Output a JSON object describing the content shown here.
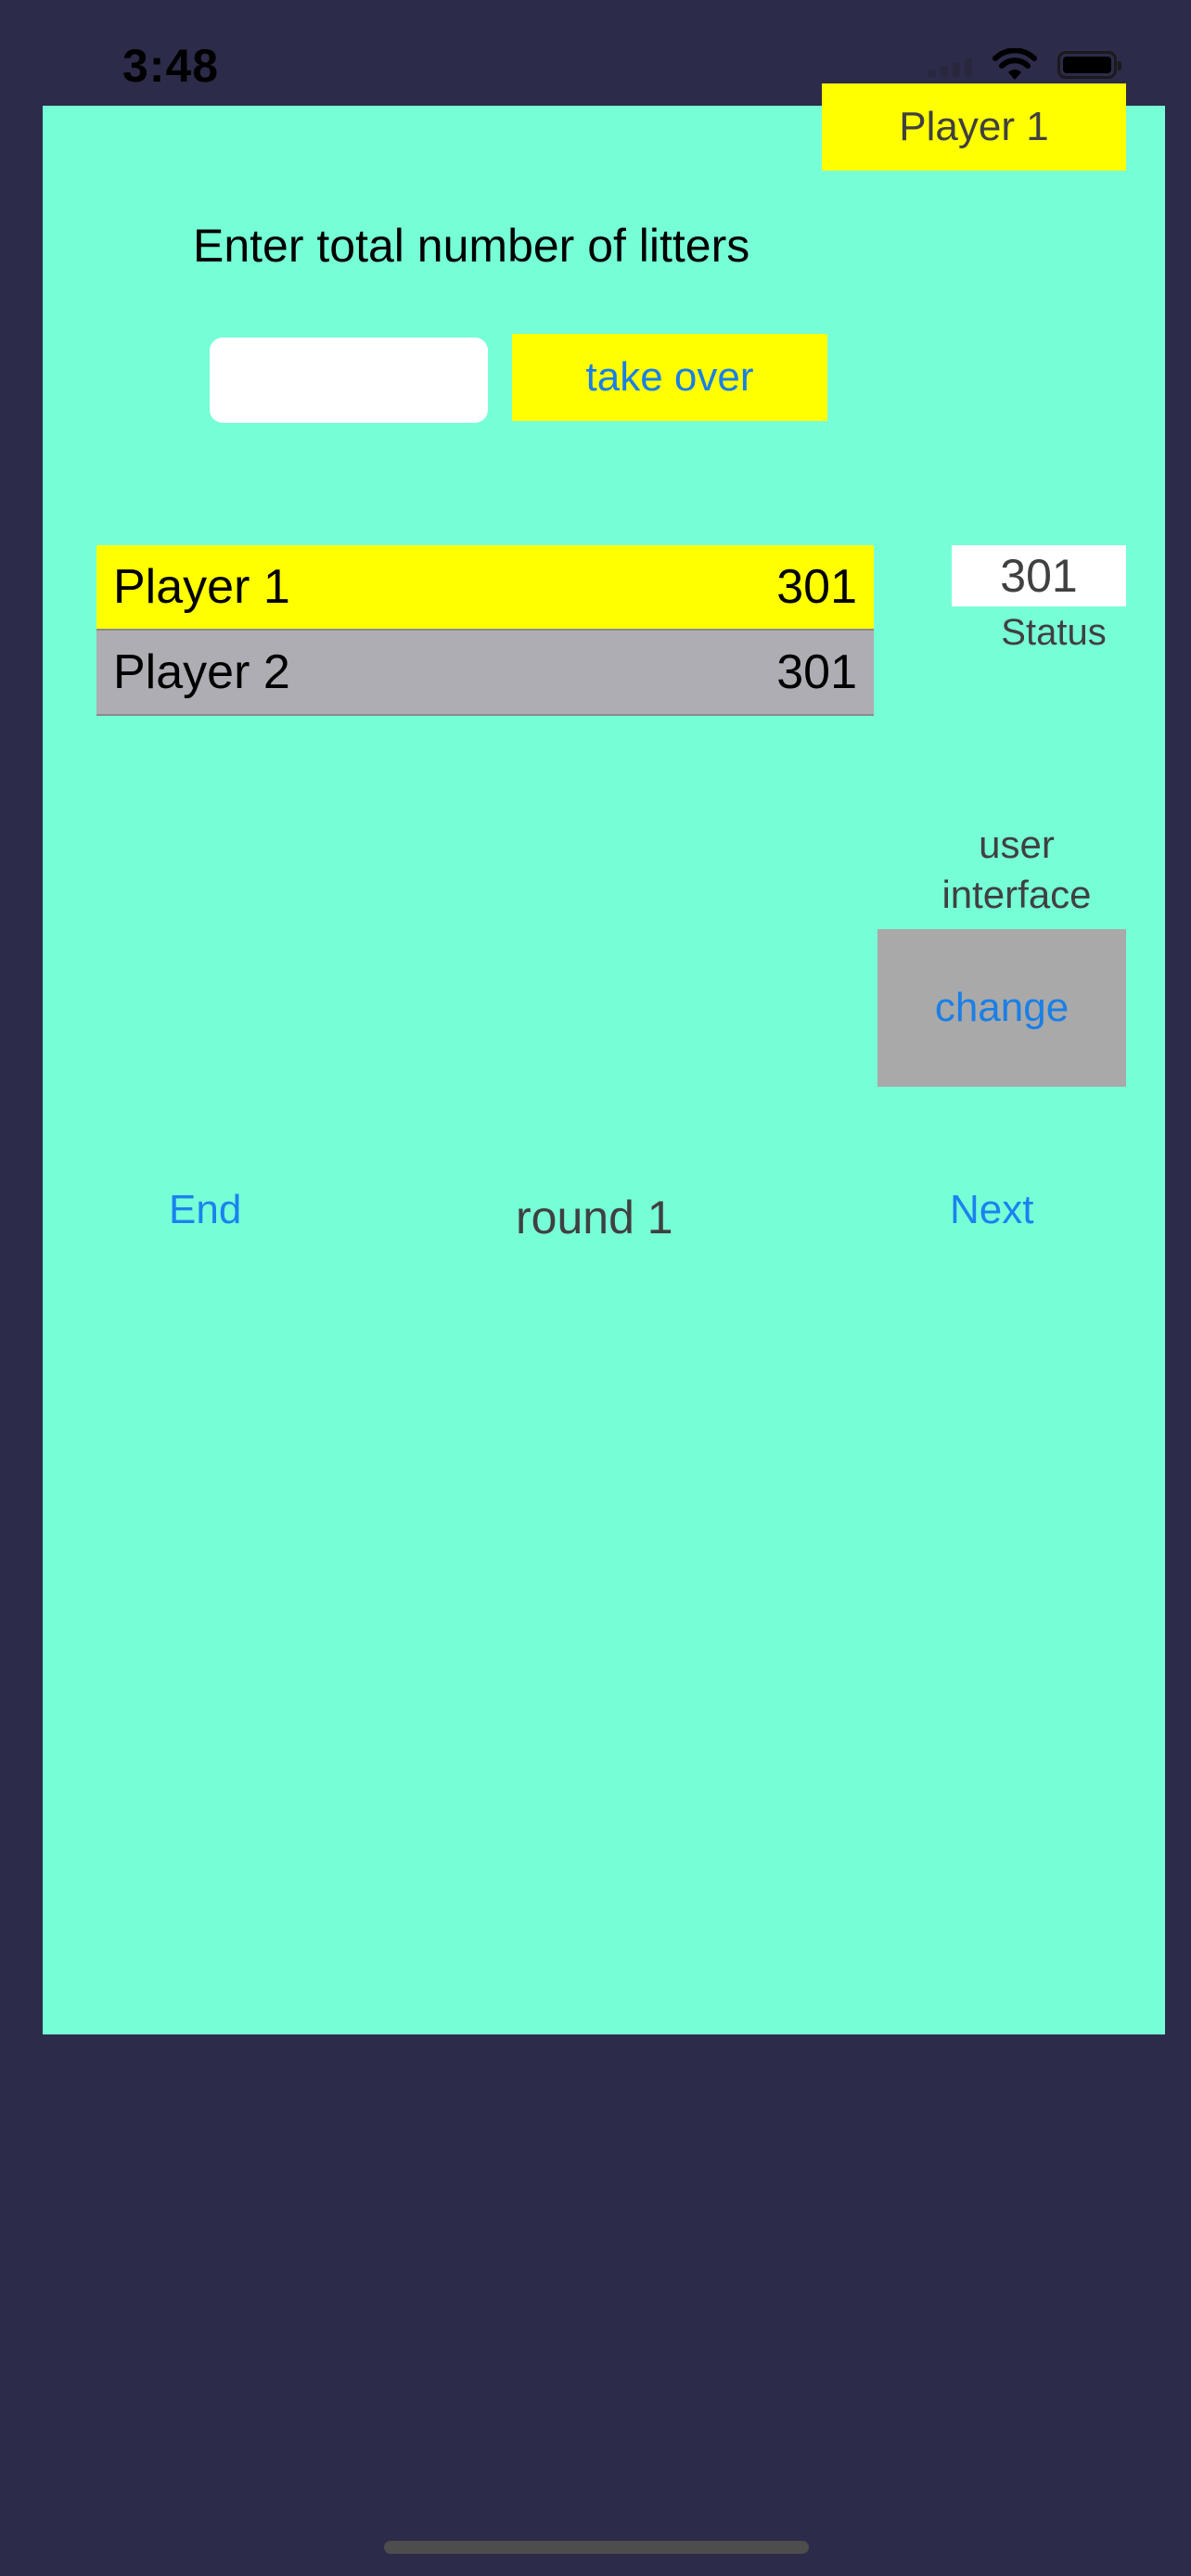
{
  "status_bar": {
    "time": "3:48"
  },
  "header": {
    "current_player": "Player 1"
  },
  "entry": {
    "prompt": "Enter total number of litters",
    "input_value": "",
    "input_placeholder": "",
    "submit_label": "take over"
  },
  "players": [
    {
      "name": "Player 1",
      "score": "301",
      "active": true
    },
    {
      "name": "Player 2",
      "score": "301",
      "active": false
    }
  ],
  "status_box": {
    "value": "301",
    "label": "Status"
  },
  "ui_section": {
    "label": "user\ninterface",
    "button_label": "change"
  },
  "footer": {
    "end_label": "End",
    "round_label": "round 1",
    "next_label": "Next"
  },
  "colors": {
    "background": "#2c2b4a",
    "panel": "#76ffd7",
    "highlight": "#ffff00",
    "inactive_row": "#aeadb3",
    "button_gray": "#a9a9a9",
    "link_blue": "#1a82f0"
  },
  "icons": {
    "signal": "cellular-signal-icon",
    "wifi": "wifi-icon",
    "battery": "battery-icon"
  }
}
